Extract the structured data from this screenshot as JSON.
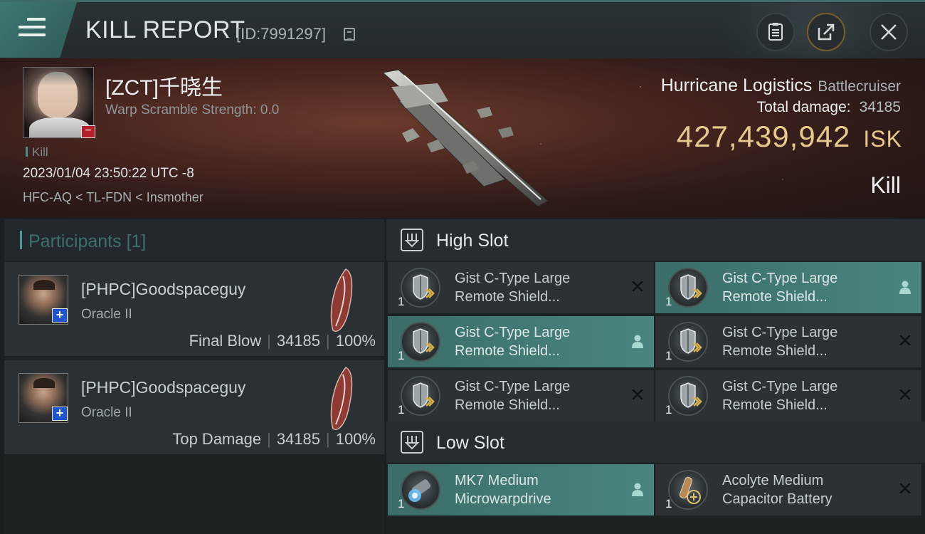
{
  "header": {
    "title": "KILL REPORT",
    "report_id": "[ID:7991297]"
  },
  "victim": {
    "name": "[ZCT]千晓生",
    "warp": "Warp Scramble Strength: 0.0",
    "kill_tag": "Kill",
    "timestamp": "2023/01/04 23:50:22 UTC -8",
    "location": "HFC-AQ < TL-FDN < Insmother",
    "ship": "Hurricane Logistics",
    "ship_class": "Battlecruiser",
    "total_damage_label": "Total damage:",
    "total_damage": "34185",
    "isk_value": "427,439,942",
    "isk_unit": "ISK",
    "result": "Kill"
  },
  "participants": {
    "label": "Participants",
    "count": "[1]",
    "items": [
      {
        "name": "[PHPC]Goodspaceguy",
        "ship": "Oracle II",
        "role": "Final Blow",
        "damage": "34185",
        "percent": "100%"
      },
      {
        "name": "[PHPC]Goodspaceguy",
        "ship": "Oracle II",
        "role": "Top Damage",
        "damage": "34185",
        "percent": "100%"
      }
    ]
  },
  "fitting": {
    "high_slot_label": "High Slot",
    "low_slot_label": "Low Slot",
    "high": [
      {
        "line1": "Gist C-Type Large",
        "line2": "Remote Shield...",
        "qty": "1",
        "state": "destroyed"
      },
      {
        "line1": "Gist C-Type Large",
        "line2": "Remote Shield...",
        "qty": "1",
        "state": "dropped"
      },
      {
        "line1": "Gist C-Type Large",
        "line2": "Remote Shield...",
        "qty": "1",
        "state": "dropped"
      },
      {
        "line1": "Gist C-Type Large",
        "line2": "Remote Shield...",
        "qty": "1",
        "state": "destroyed"
      },
      {
        "line1": "Gist C-Type Large",
        "line2": "Remote Shield...",
        "qty": "1",
        "state": "destroyed"
      },
      {
        "line1": "Gist C-Type Large",
        "line2": "Remote Shield...",
        "qty": "1",
        "state": "destroyed"
      }
    ],
    "low": [
      {
        "line1": "MK7 Medium",
        "line2": "Microwarpdrive",
        "qty": "1",
        "state": "dropped"
      },
      {
        "line1": "Acolyte Medium",
        "line2": "Capacitor Battery",
        "qty": "1",
        "state": "destroyed"
      }
    ]
  },
  "icons": {
    "menu": "hamburger-menu-icon",
    "notes": "clipboard-icon",
    "share": "share-export-icon",
    "close": "close-icon",
    "copy": "copy-icon",
    "destroyed": "x-mark-icon",
    "dropped": "person-icon"
  },
  "colors": {
    "accent": "#4a8580",
    "isk": "#e6c98c",
    "victim_badge": "#b3202a",
    "attacker_badge": "#1f55c8"
  }
}
